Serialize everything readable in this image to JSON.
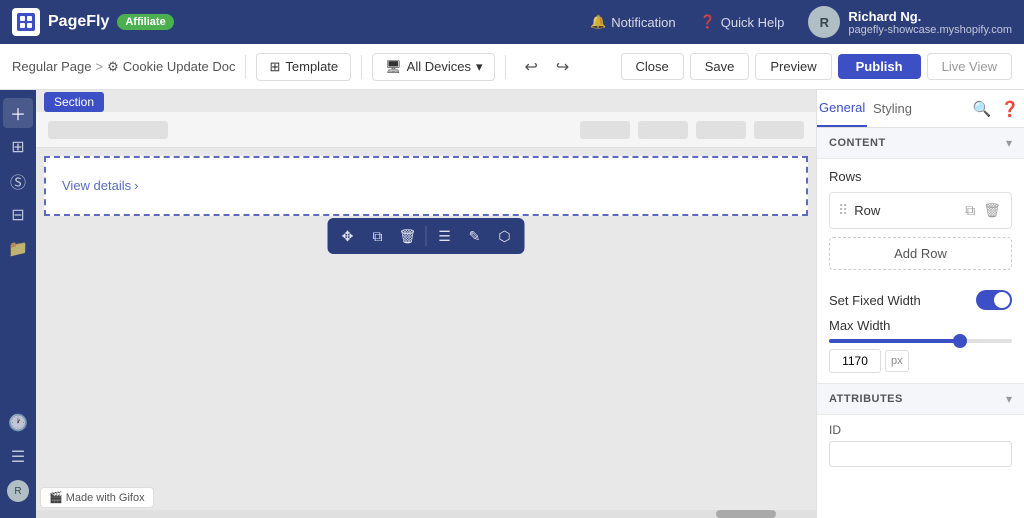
{
  "topNav": {
    "logoText": "PageFly",
    "affiliateBadge": "Affiliate",
    "notificationLabel": "Notification",
    "quickHelpLabel": "Quick Help",
    "userName": "Richard Ng.",
    "userShop": "pagefly-showcase.myshopify.com",
    "avatarInitial": "R"
  },
  "toolbar": {
    "breadcrumbPage": "Regular Page",
    "breadcrumbSep": ">",
    "breadcrumbDoc": "Cookie Update Doc",
    "templateLabel": "Template",
    "allDevicesLabel": "All Devices",
    "closeLabel": "Close",
    "saveLabel": "Save",
    "previewLabel": "Preview",
    "publishLabel": "Publish",
    "liveViewLabel": "Live View"
  },
  "canvas": {
    "sectionTagLabel": "Section",
    "viewDetailsLabel": "View details",
    "viewDetailsChevron": "›"
  },
  "floatingToolbar": {
    "icons": [
      "⊕",
      "⧉",
      "🗑",
      "☰",
      "✎",
      "⬡"
    ]
  },
  "rightPanel": {
    "generalTab": "General",
    "stylingTab": "Styling",
    "contentSectionLabel": "CONTENT",
    "rowsLabel": "Rows",
    "rowItem": "Row",
    "addRowLabel": "Add Row",
    "setFixedWidthLabel": "Set Fixed Width",
    "maxWidthLabel": "Max Width",
    "maxWidthValue": "1170",
    "maxWidthUnit": "px",
    "attributesSectionLabel": "ATTRIBUTES",
    "idLabel": "ID",
    "idPlaceholder": ""
  },
  "gifBadge": {
    "label": "Made with Gifox"
  }
}
